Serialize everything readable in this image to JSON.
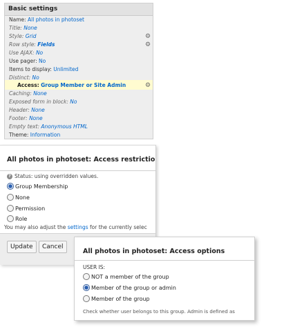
{
  "basic_settings": {
    "title": "Basic settings",
    "rows": [
      {
        "label": "Name:",
        "value": "All photos in photoset",
        "italic": false
      },
      {
        "label": "Title:",
        "value": "None",
        "italic": true
      },
      {
        "label": "Style:",
        "value": "Grid",
        "italic": true
      },
      {
        "label": "Row style:",
        "value": "Fields",
        "italic": true,
        "bold_value": true
      },
      {
        "label": "Use AJAX:",
        "value": "No",
        "italic": true
      },
      {
        "label": "Use pager:",
        "value": "No",
        "italic": false
      },
      {
        "label": "Items to display:",
        "value": "Unlimited",
        "italic": false
      },
      {
        "label": "Distinct:",
        "value": "No",
        "italic": true
      },
      {
        "label": "Access:",
        "value": "Group Member or Site Admin",
        "italic": false,
        "highlight": true
      },
      {
        "label": "Caching:",
        "value": "None",
        "italic": true
      },
      {
        "label": "Exposed form in block:",
        "value": "No",
        "italic": true
      },
      {
        "label": "Header:",
        "value": "None",
        "italic": true
      },
      {
        "label": "Footer:",
        "value": "None",
        "italic": true
      },
      {
        "label": "Empty text:",
        "value": "Anonymous HTML",
        "italic": true
      },
      {
        "label": "Theme:",
        "value": "Information",
        "italic": false
      }
    ]
  },
  "access_restrictions": {
    "title": "All photos in photoset: Access restrictions",
    "status": "Status: using overridden values.",
    "options": [
      "Group Membership",
      "None",
      "Permission",
      "Role"
    ],
    "selected_index": 0,
    "note_prefix": "You may also adjust the ",
    "note_link": "settings",
    "note_suffix": " for the currently selec",
    "buttons": {
      "update": "Update",
      "cancel": "Cancel"
    }
  },
  "access_options": {
    "title": "All photos in photoset: Access options",
    "user_is_label": "USER IS:",
    "options": [
      "NOT a member of the group",
      "Member of the group or admin",
      "Member of the group"
    ],
    "selected_index": 1,
    "description": "Check whether user belongs to this group. Admin is defined as"
  },
  "colors": {
    "link": "#0066cc",
    "highlight": "#fffbd0",
    "panel_bg": "#eeeeee"
  },
  "icons": [
    "gear-icon",
    "help-icon"
  ]
}
